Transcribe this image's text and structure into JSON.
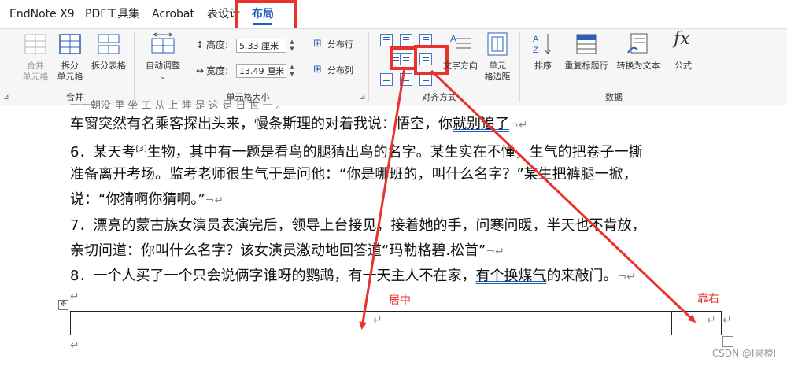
{
  "tabs": [
    {
      "label": "EndNote X9",
      "active": false
    },
    {
      "label": "PDF工具集",
      "active": false
    },
    {
      "label": "Acrobat",
      "active": false
    },
    {
      "label": "表设计",
      "active": false
    },
    {
      "label": "布局",
      "active": true
    }
  ],
  "ribbon": {
    "merge": {
      "merge_cells": "合并\n单元格",
      "split_cells": "拆分\n单元格",
      "split_table": "拆分表格",
      "group": "合并"
    },
    "cell_size": {
      "autofit": "自动调整",
      "height_label": "高度:",
      "height_value": "5.33 厘米",
      "width_label": "宽度:",
      "width_value": "13.49 厘米",
      "distribute_rows": "分布行",
      "distribute_cols": "分布列",
      "group": "单元格大小"
    },
    "alignment": {
      "text_direction": "文字方向",
      "cell_margins": "单元\n格边距",
      "group": "对齐方式"
    },
    "data": {
      "sort": "排序",
      "repeat_header": "重复标题行",
      "convert_text": "转换为文本",
      "formula": "公式",
      "group": "数据"
    }
  },
  "document": {
    "partial_line": "一一朝没 里 坐 工 从 上 睡 是  这 是 日 世 一 。",
    "line1a": "车窗突然有名乘客探出头来，慢条斯理的对着我说：悟空，你",
    "line1b": "就别追了",
    "line2a": "6．某天考",
    "line2sup": "[3]",
    "line2b": "生物，其中有一题是看鸟的腿猜出鸟的名字。某生实在不懂，生气的把卷子一撕",
    "line3": "准备离开考场。监考老师很生气于是问他：“你是哪班的，叫什么名字？”某生把裤腿一掀，",
    "line4": "说：“你猜啊你猜啊。”",
    "line5": "7．漂亮的蒙古族女演员表演完后，领导上台接见，接着她的手，问寒问暖，半天也不肯放，",
    "line6": "亲切问道：你叫什么名字？该女演员激动地回答道“玛勒格碧.松首”",
    "line7a": "8．一个人买了一个只会说俩字谁呀的鹦鹉，有一天主人不在家，",
    "line7b": "有个换煤气",
    "line7c": "的来敲门。",
    "para_mark": "¬↵",
    "enter_mark": "↵"
  },
  "annotations": {
    "center": "居中",
    "right": "靠右"
  },
  "watermark": "CSDN @I果橙I"
}
